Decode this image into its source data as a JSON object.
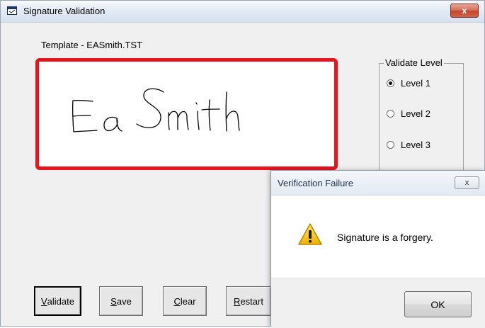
{
  "window": {
    "title": "Signature Validation",
    "close_label": "x"
  },
  "template_label": "Template - EASmith.TST",
  "signature": {
    "text": "Ea Smith",
    "border_color": "#e8141e"
  },
  "validate_level": {
    "legend": "Validate Level",
    "options": [
      {
        "label": "Level 1",
        "selected": true
      },
      {
        "label": "Level 2",
        "selected": false
      },
      {
        "label": "Level 3",
        "selected": false
      }
    ]
  },
  "buttons": {
    "validate": {
      "mnemonic": "V",
      "rest": "alidate"
    },
    "save": {
      "mnemonic": "S",
      "rest": "ave"
    },
    "clear": {
      "mnemonic": "C",
      "rest": "lear"
    },
    "restart": {
      "mnemonic": "R",
      "rest": "estart"
    }
  },
  "dialog": {
    "title": "Verification Failure",
    "close_label": "x",
    "icon": "warning-icon",
    "message": "Signature is a forgery.",
    "ok_label": "OK"
  }
}
